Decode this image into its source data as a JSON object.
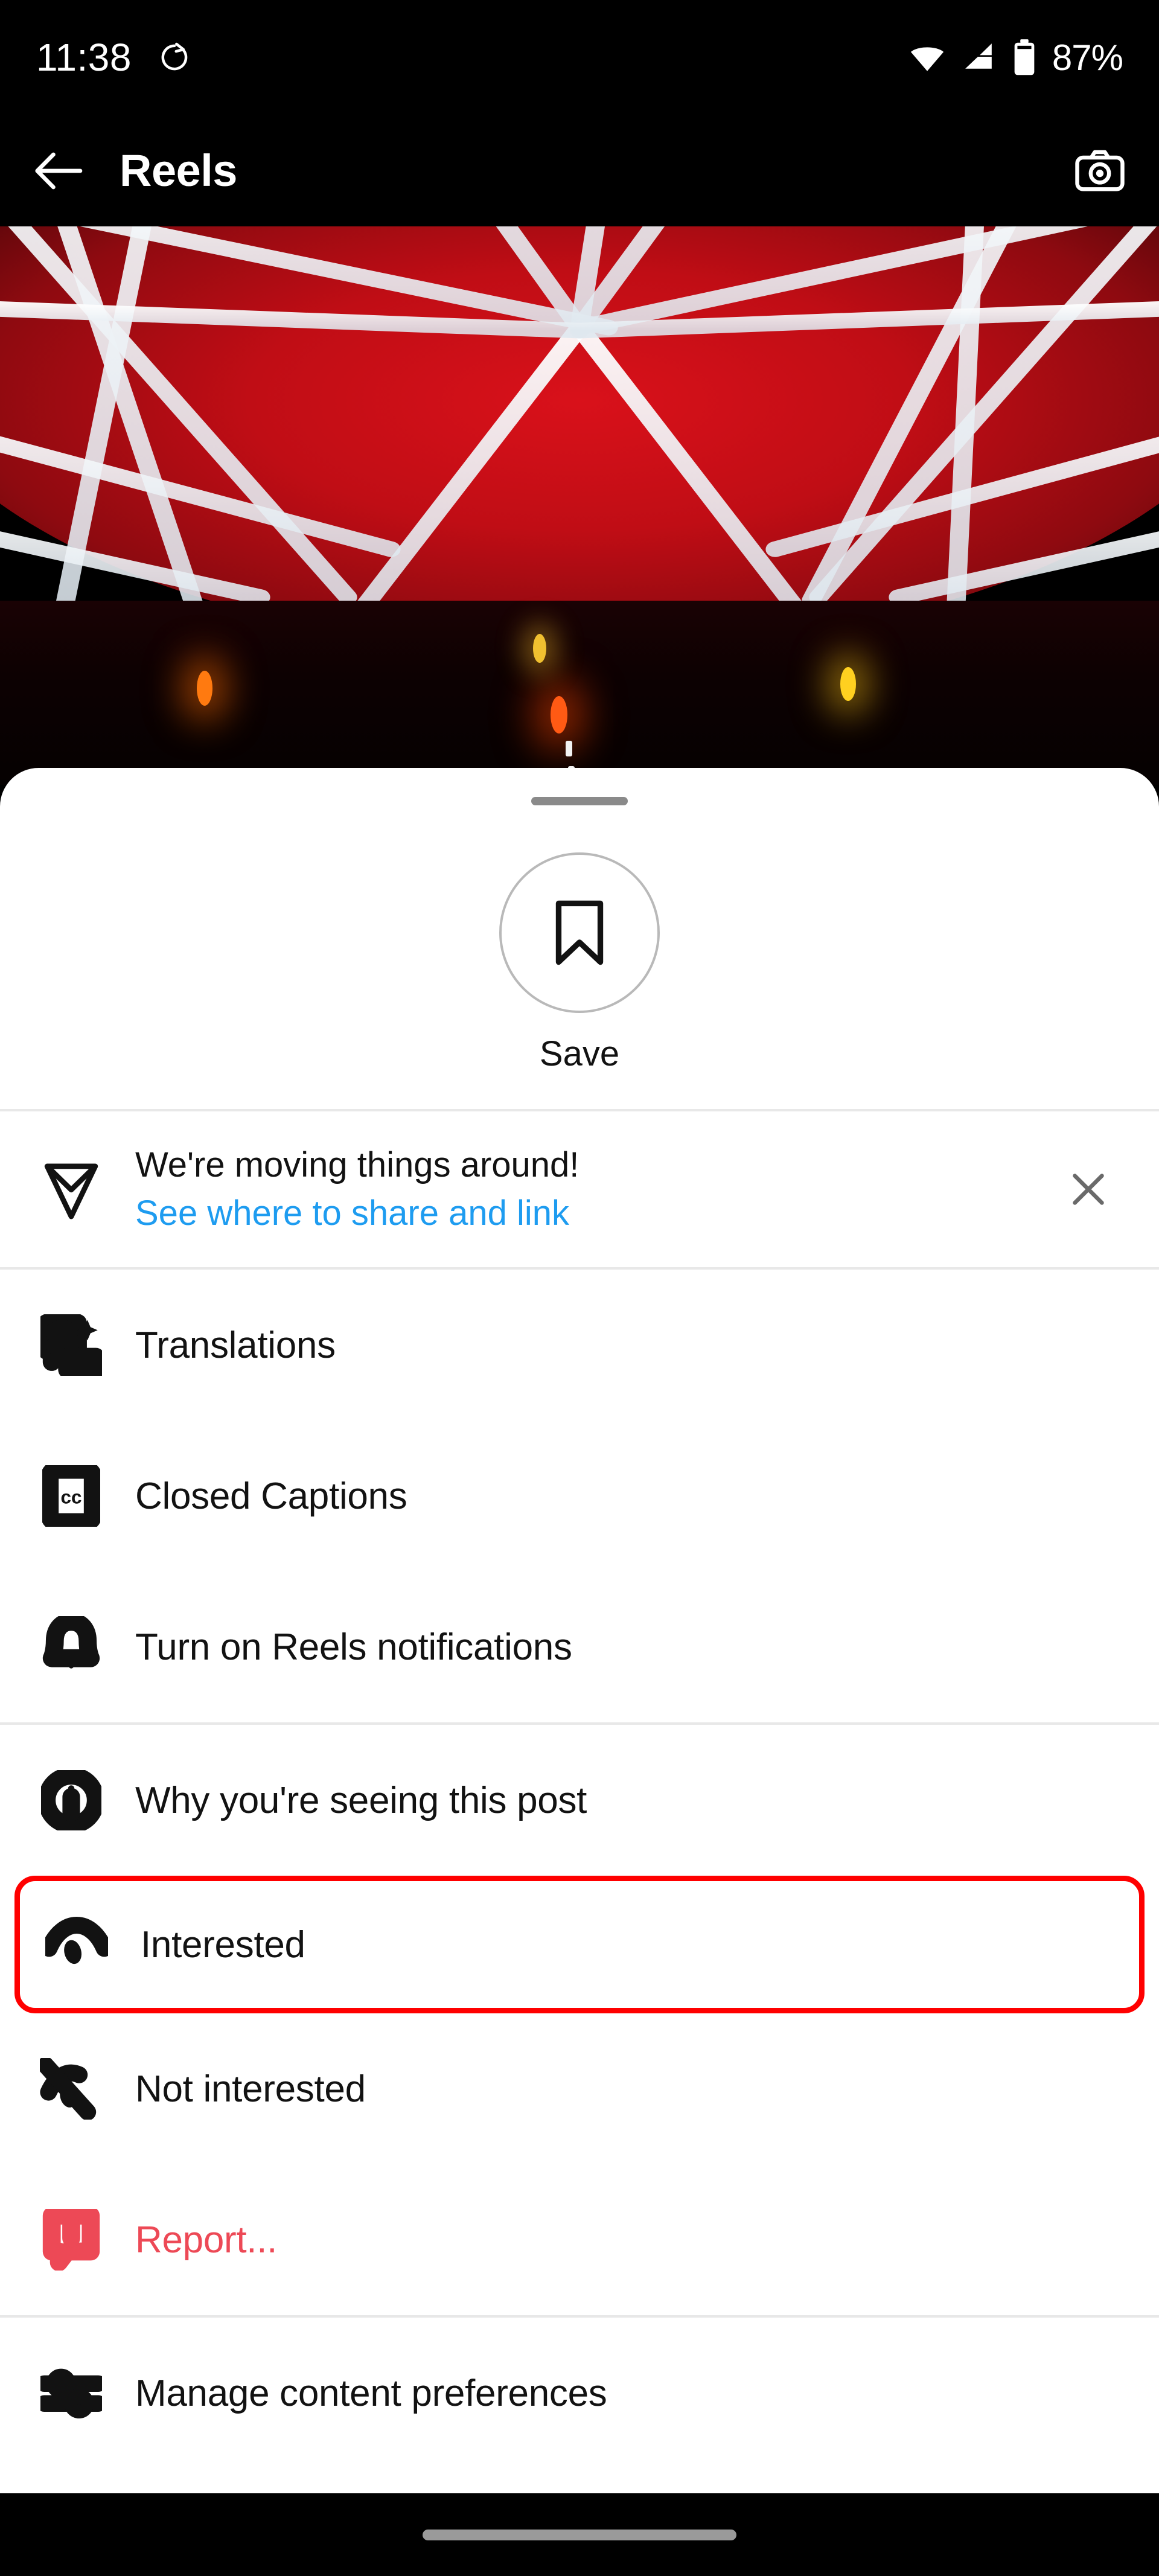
{
  "status_bar": {
    "time": "11:38",
    "rotation_icon": "rotate-icon",
    "wifi_icon": "wifi-icon",
    "signal_icon": "cellular-signal-icon",
    "battery_icon": "battery-icon",
    "battery_label": "87%"
  },
  "header": {
    "back_icon": "back-arrow-icon",
    "title": "Reels",
    "camera_icon": "camera-icon"
  },
  "video": {
    "description": "red-lit arena ceiling with white crisscross beams"
  },
  "sheet": {
    "grabber": "drag-handle",
    "save": {
      "icon": "bookmark-icon",
      "label": "Save"
    },
    "banner": {
      "icon": "send-paper-plane-icon",
      "title": "We're moving things around!",
      "link": "See where to share and link",
      "close_icon": "close-icon"
    },
    "menu_items": [
      {
        "icon": "translate-icon",
        "label": "Translations",
        "style": "normal",
        "highlighted": false
      },
      {
        "icon": "closed-captions-icon",
        "label": "Closed Captions",
        "style": "normal",
        "highlighted": false
      },
      {
        "icon": "bell-icon",
        "label": "Turn on Reels notifications",
        "style": "normal",
        "highlighted": false
      },
      {
        "icon": "info-circle-icon",
        "label": "Why you're seeing this post",
        "style": "normal",
        "highlighted": false
      },
      {
        "icon": "eye-icon",
        "label": "Interested",
        "style": "normal",
        "highlighted": true
      },
      {
        "icon": "eye-off-icon",
        "label": "Not interested",
        "style": "normal",
        "highlighted": false
      },
      {
        "icon": "report-warning-icon",
        "label": "Report...",
        "style": "danger",
        "highlighted": false
      },
      {
        "icon": "sliders-icon",
        "label": "Manage content preferences",
        "style": "normal",
        "highlighted": false
      }
    ]
  },
  "nav_bar": {
    "gesture_pill": "home-gesture-pill"
  },
  "colors": {
    "accent_blue": "#1e9cf0",
    "danger_red": "#ed4956",
    "highlight_red": "#ff0000",
    "sheet_bg": "#ffffff",
    "system_bg": "#000000",
    "video_red": "#d9111a"
  }
}
